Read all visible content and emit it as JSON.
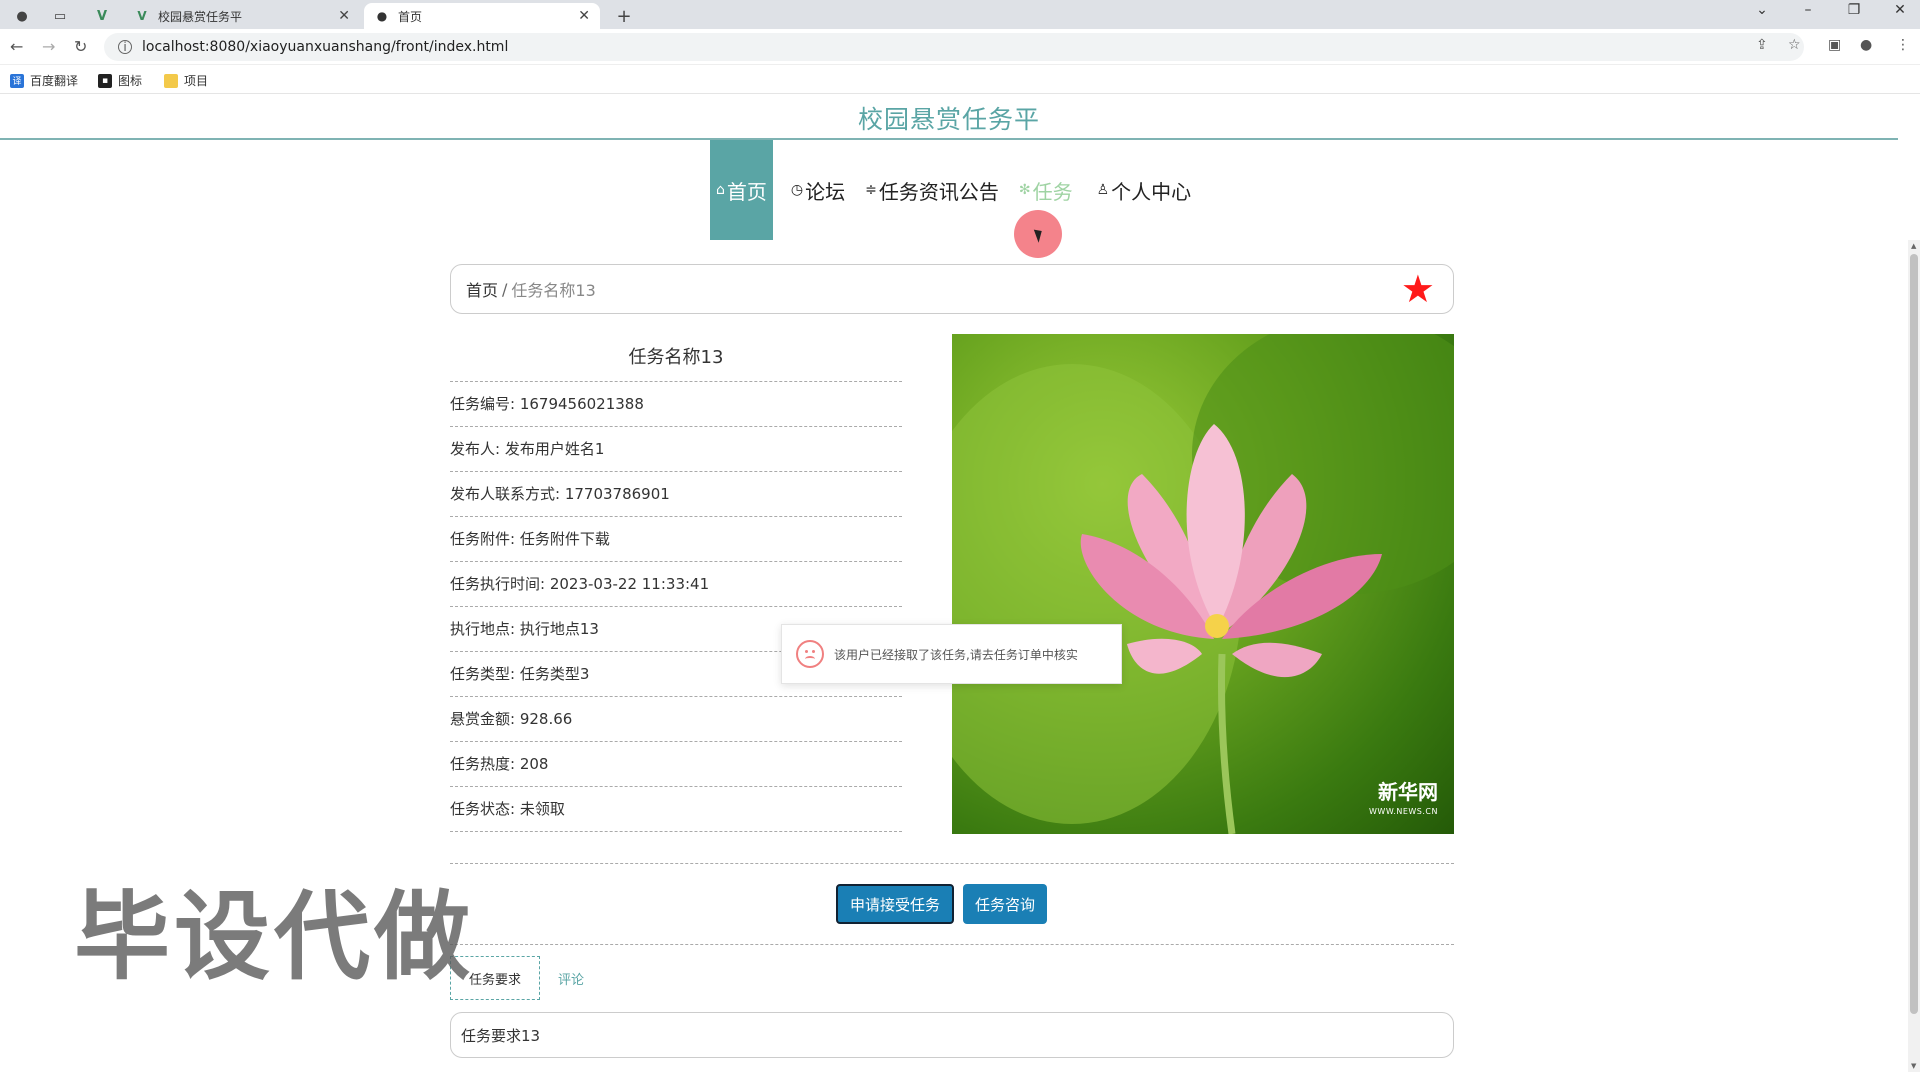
{
  "browser": {
    "tabs": [
      {
        "title": "校园悬赏任务平",
        "active": false
      },
      {
        "title": "首页",
        "active": true
      }
    ],
    "url": "localhost:8080/xiaoyuanxuanshang/front/index.html",
    "bookmarks": [
      "百度翻译",
      "图标",
      "项目"
    ]
  },
  "site": {
    "title": "校园悬赏任务平"
  },
  "nav": {
    "items": [
      {
        "label": "首页",
        "icon": "home-icon",
        "state": "active"
      },
      {
        "label": "论坛",
        "icon": "clock-icon",
        "state": "normal"
      },
      {
        "label": "任务资讯公告",
        "icon": "sliders-icon",
        "state": "normal"
      },
      {
        "label": "任务",
        "icon": "asterisk-icon",
        "state": "hover"
      },
      {
        "label": "个人中心",
        "icon": "user-icon",
        "state": "normal"
      }
    ]
  },
  "breadcrumb": {
    "home": "首页",
    "separator": "/",
    "current": "任务名称13"
  },
  "task": {
    "title": "任务名称13",
    "rows": [
      "任务编号: 1679456021388",
      "发布人: 发布用户姓名1",
      "发布人联系方式: 17703786901",
      "任务附件: 任务附件下载",
      "任务执行时间: 2023-03-22 11:33:41",
      "执行地点: 执行地点13",
      "任务类型: 任务类型3",
      "悬赏金额: 928.66",
      "任务热度: 208",
      "任务状态: 未领取"
    ]
  },
  "photo": {
    "watermark_main": "新华网",
    "watermark_sub": "WWW.NEWS.CN"
  },
  "toast": {
    "message": "该用户已经接取了该任务,请去任务订单中核实"
  },
  "buttons": {
    "apply": "申请接受任务",
    "consult": "任务咨询"
  },
  "detail_tabs": {
    "requirements": "任务要求",
    "comments": "评论"
  },
  "requirements_text": "任务要求13",
  "overlay_watermark": "毕设代做",
  "colors": {
    "accent": "#5aa5a5",
    "button": "#1a7fb5",
    "star": "#ff1a1a",
    "hover_nav": "#9fd3a3"
  }
}
